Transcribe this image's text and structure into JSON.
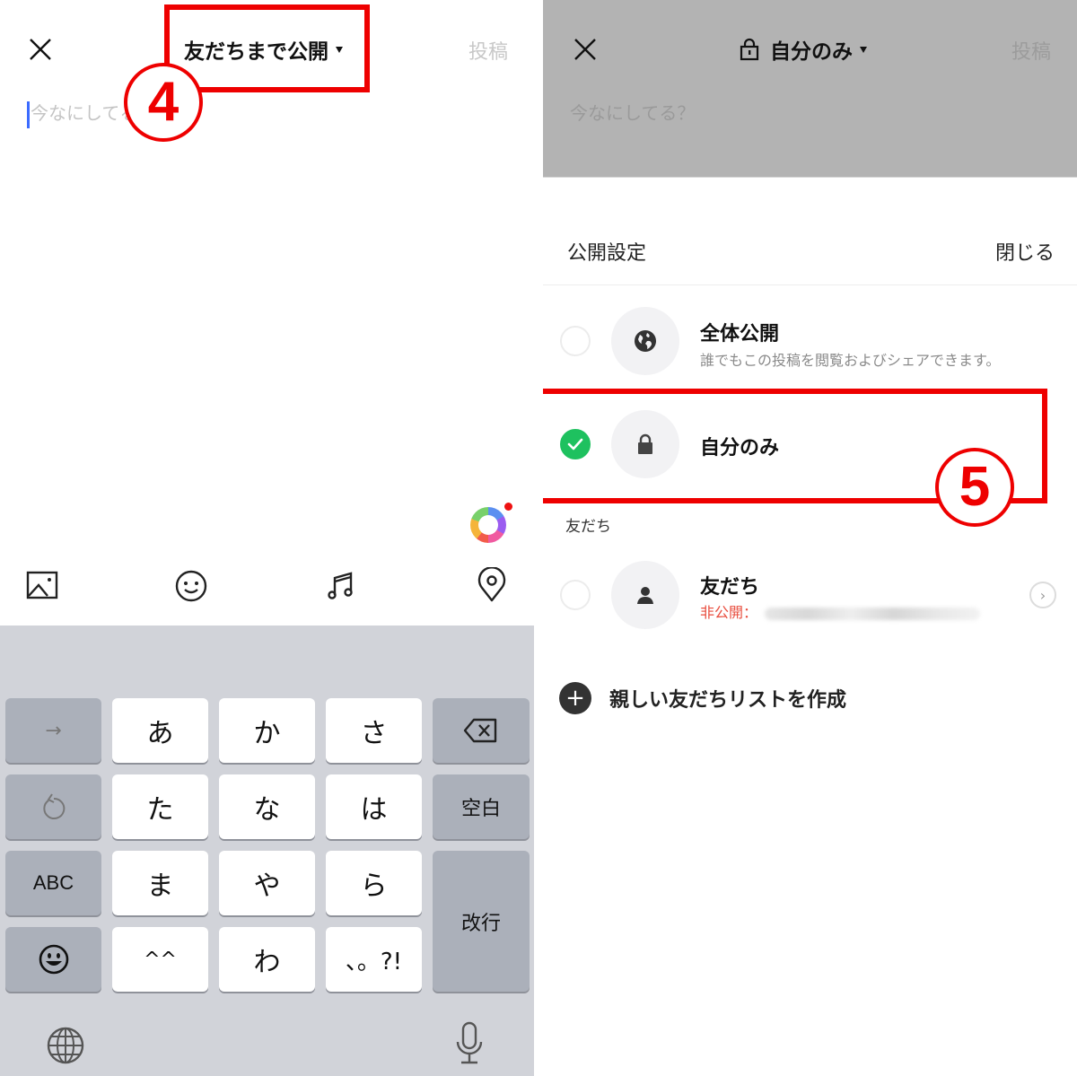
{
  "left_screen": {
    "header": {
      "close_icon": "close-icon",
      "privacy_label": "友だちまで公開",
      "post_label": "投稿"
    },
    "compose_placeholder": "今なにしてる？",
    "annotation_step": "4",
    "toolbar": {
      "icons": [
        "image-icon",
        "emoji-icon",
        "music-icon",
        "location-icon"
      ],
      "effects_icon": "color-ring-icon"
    },
    "keyboard": {
      "rows": [
        [
          "→",
          "あ",
          "か",
          "さ",
          "⌫"
        ],
        [
          "↺",
          "た",
          "な",
          "は",
          "空白"
        ],
        [
          "ABC",
          "ま",
          "や",
          "ら",
          "改行"
        ],
        [
          "☺",
          "^^",
          "わ",
          "、。?!"
        ]
      ],
      "arrow_key": "→",
      "undo_key": "↺",
      "abc_key": "ABC",
      "space_key": "空白",
      "return_key": "改行",
      "emoji_key": "emoji-icon",
      "globe_icon": "globe-icon",
      "mic_icon": "microphone-icon"
    }
  },
  "right_screen": {
    "header": {
      "lock_icon": "lock-icon",
      "privacy_label": "自分のみ",
      "post_label": "投稿"
    },
    "compose_placeholder": "今なにしてる？",
    "sheet": {
      "title": "公開設定",
      "close_label": "閉じる",
      "options": [
        {
          "title": "全体公開",
          "description": "誰でもこの投稿を閲覧およびシェアできます。",
          "icon": "globe-icon",
          "selected": false
        },
        {
          "title": "自分のみ",
          "description": "",
          "icon": "lock-icon",
          "selected": true
        }
      ],
      "friends_section_label": "友だち",
      "friends_option": {
        "title": "友だち",
        "private_prefix": "非公開：",
        "icon": "person-icon",
        "selected": false
      },
      "create_list_label": "親しい友だちリストを作成"
    },
    "annotation_step": "5"
  },
  "colors": {
    "annotation_red": "#ee0000",
    "check_green": "#1ec15f",
    "cursor_blue": "#3b6bff",
    "private_red": "#e84c3d",
    "overlay_gray": "#b3b3b3",
    "keyboard_bg": "#d1d3d9"
  }
}
